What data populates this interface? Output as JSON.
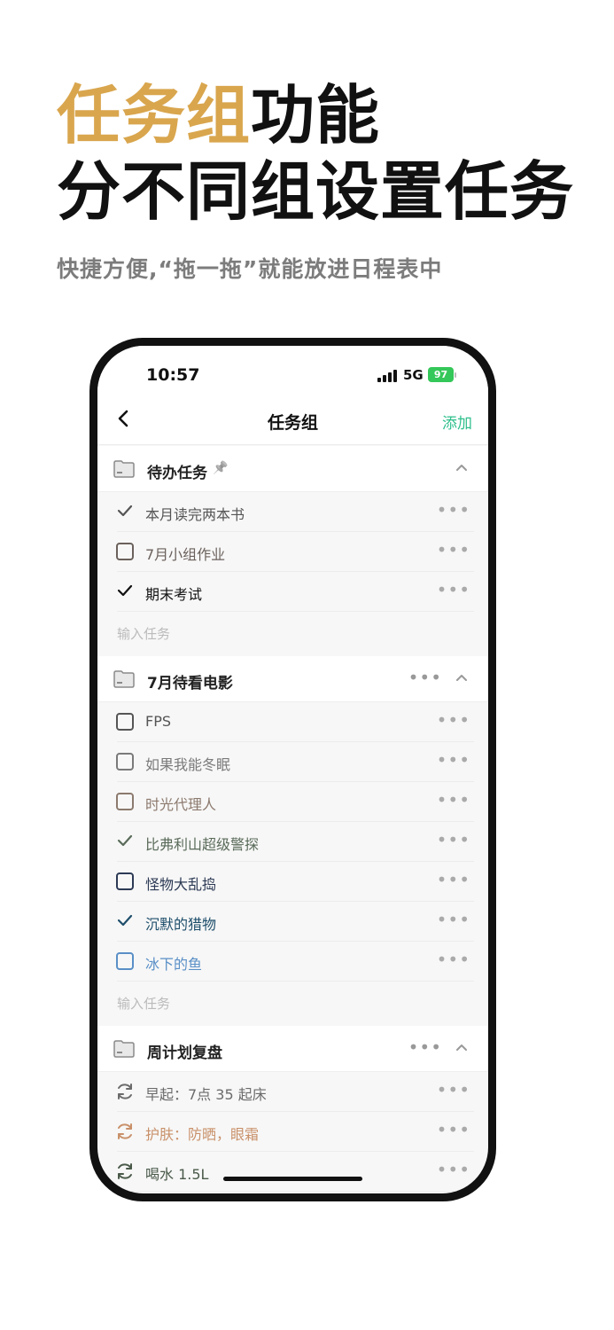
{
  "hero": {
    "title_accent": "任务组",
    "title_rest": "功能",
    "line2": "分不同组设置任务",
    "subtitle": "快捷方便,“拖一拖”就能放进日程表中"
  },
  "status": {
    "time": "10:57",
    "network": "5G",
    "battery": "97"
  },
  "nav": {
    "back_icon": "chevron-left-icon",
    "title": "任务组",
    "add_label": "添加"
  },
  "colors": {
    "accent": "#d9a64e",
    "add": "#2fbf8c",
    "battery": "#34c759"
  },
  "groups": [
    {
      "title": "待办任务",
      "pinned": true,
      "tasks": [
        {
          "label": "本月读完两本书",
          "type": "done",
          "color": "#555555"
        },
        {
          "label": "7月小组作业",
          "type": "todo",
          "color": "#6b615c"
        },
        {
          "label": "期末考试",
          "type": "done",
          "color": "#111111"
        }
      ],
      "input_placeholder": "输入任务"
    },
    {
      "title": "7月待看电影",
      "pinned": false,
      "tasks": [
        {
          "label": "FPS",
          "type": "todo",
          "color": "#555555"
        },
        {
          "label": "如果我能冬眠",
          "type": "todo",
          "color": "#7a7a7a"
        },
        {
          "label": "时光代理人",
          "type": "todo",
          "color": "#8c7a6e"
        },
        {
          "label": "比弗利山超级警探",
          "type": "done",
          "color": "#5a6b5a"
        },
        {
          "label": "怪物大乱捣",
          "type": "todo",
          "color": "#2c3a55"
        },
        {
          "label": "沉默的猎物",
          "type": "done",
          "color": "#1e4e6b"
        },
        {
          "label": "冰下的鱼",
          "type": "todo",
          "color": "#5a8fc7"
        }
      ],
      "input_placeholder": "输入任务"
    },
    {
      "title": "周计划复盘",
      "pinned": false,
      "tasks": [
        {
          "label": "早起：7点 35 起床",
          "type": "repeat",
          "color": "#6b6b6b"
        },
        {
          "label": "护肤：防晒，眼霜",
          "type": "repeat",
          "color": "#c9916a"
        },
        {
          "label": "喝水 1.5L",
          "type": "repeat",
          "color": "#4a5a4a"
        }
      ]
    }
  ]
}
